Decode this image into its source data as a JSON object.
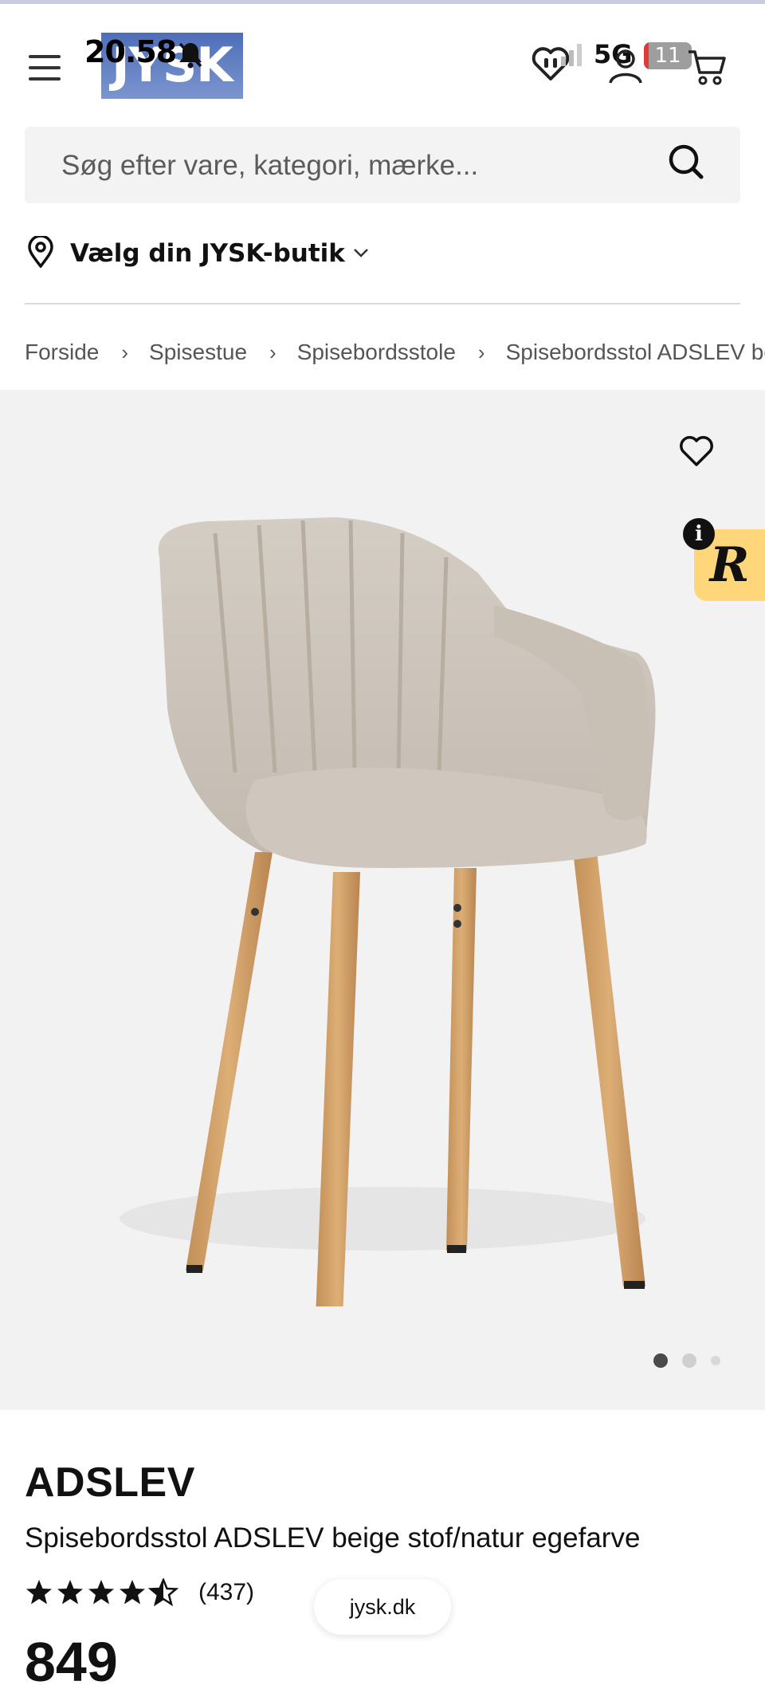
{
  "status_bar": {
    "time": "20.58",
    "network": "5G",
    "battery": "11"
  },
  "header": {
    "logo_text": "JYSK"
  },
  "search": {
    "placeholder": "Søg efter vare, kategori, mærke..."
  },
  "store_picker": {
    "label": "Vælg din JYSK-butik"
  },
  "breadcrumb": [
    "Forside",
    "Spisestue",
    "Spisebordsstole",
    "Spisebordsstol ADSLEV be"
  ],
  "gallery": {
    "image_count": 3,
    "active_index": 0
  },
  "badge": {
    "letter": "R",
    "info": "i"
  },
  "product": {
    "brand": "ADSLEV",
    "name": "Spisebordsstol ADSLEV beige stof/natur egefarve",
    "rating": 4.5,
    "review_count": "(437)",
    "price_partial": "849"
  },
  "browser": {
    "url": "jysk.dk"
  },
  "colors": {
    "accent_yellow": "#ffd77a",
    "logo_blue": "#5a78c0",
    "gallery_bg": "#f3f2f2"
  }
}
